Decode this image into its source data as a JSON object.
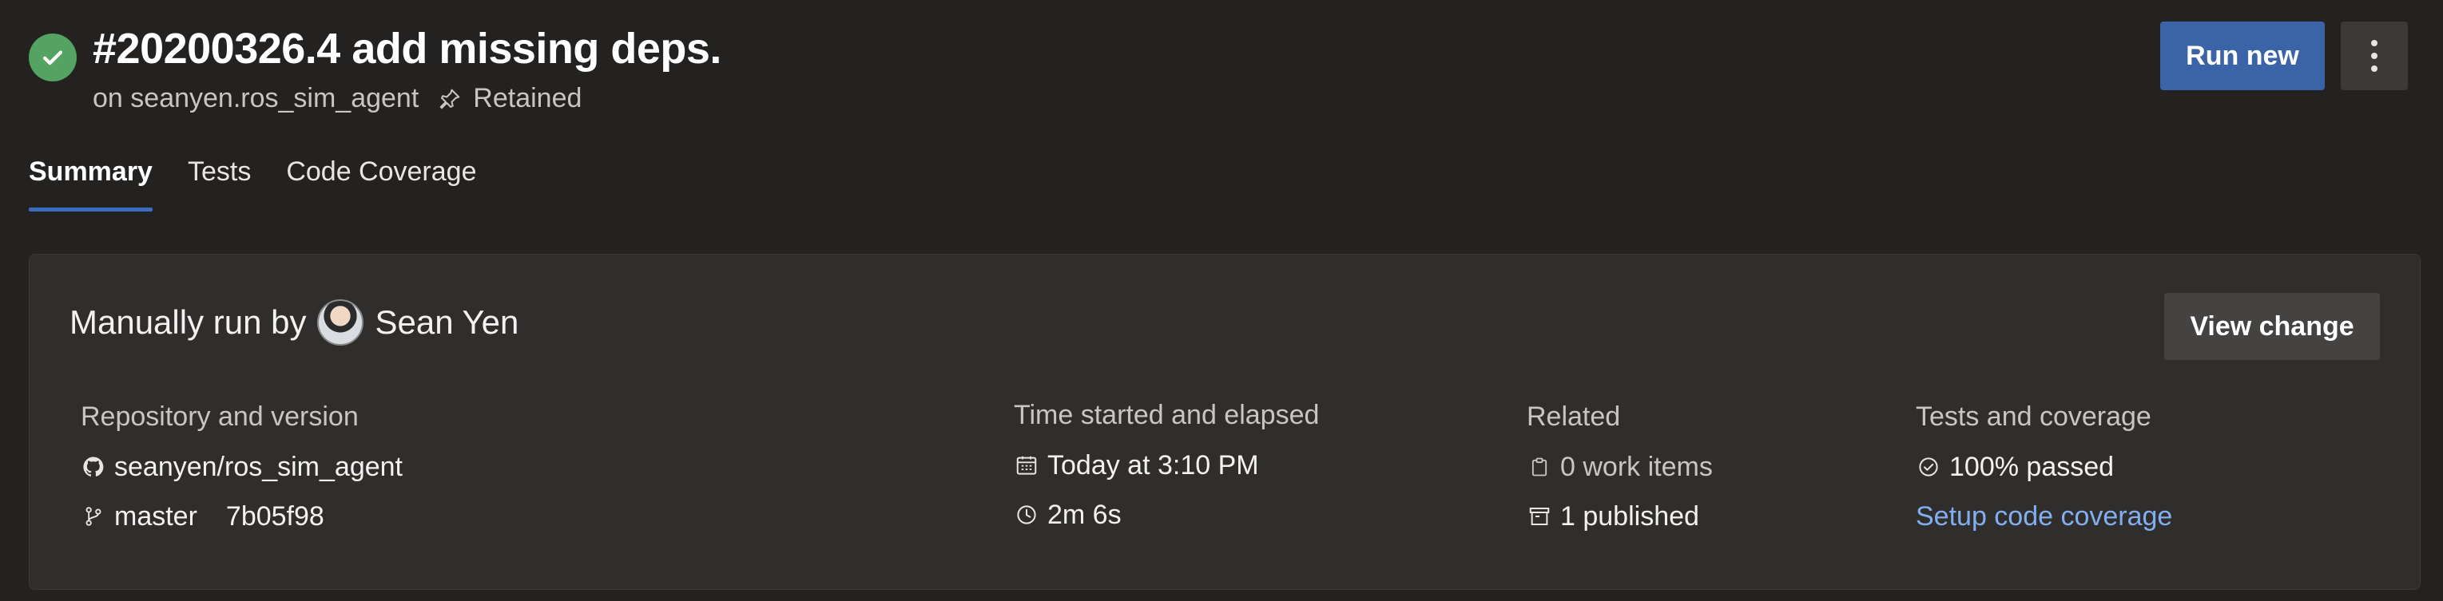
{
  "header": {
    "title": "#20200326.4 add missing deps.",
    "branch_prefix": "on",
    "agent": "seanyen.ros_sim_agent",
    "retained_label": "Retained",
    "run_new_label": "Run new"
  },
  "tabs": [
    {
      "label": "Summary",
      "active": true
    },
    {
      "label": "Tests",
      "active": false
    },
    {
      "label": "Code Coverage",
      "active": false
    }
  ],
  "summary": {
    "run_prefix": "Manually run by",
    "user_name": "Sean Yen",
    "view_change_label": "View change",
    "repository": {
      "heading": "Repository and version",
      "repo": "seanyen/ros_sim_agent",
      "branch": "master",
      "commit": "7b05f98"
    },
    "time": {
      "heading": "Time started and elapsed",
      "started": "Today at 3:10 PM",
      "elapsed": "2m 6s"
    },
    "related": {
      "heading": "Related",
      "work_items": "0 work items",
      "published": "1 published"
    },
    "tests": {
      "heading": "Tests and coverage",
      "passed": "100% passed",
      "coverage_link": "Setup code coverage"
    }
  },
  "colors": {
    "success": "#55a362",
    "primary_button": "#3a63a8",
    "tab_underline": "#3a6cc2",
    "link": "#83aef0"
  }
}
